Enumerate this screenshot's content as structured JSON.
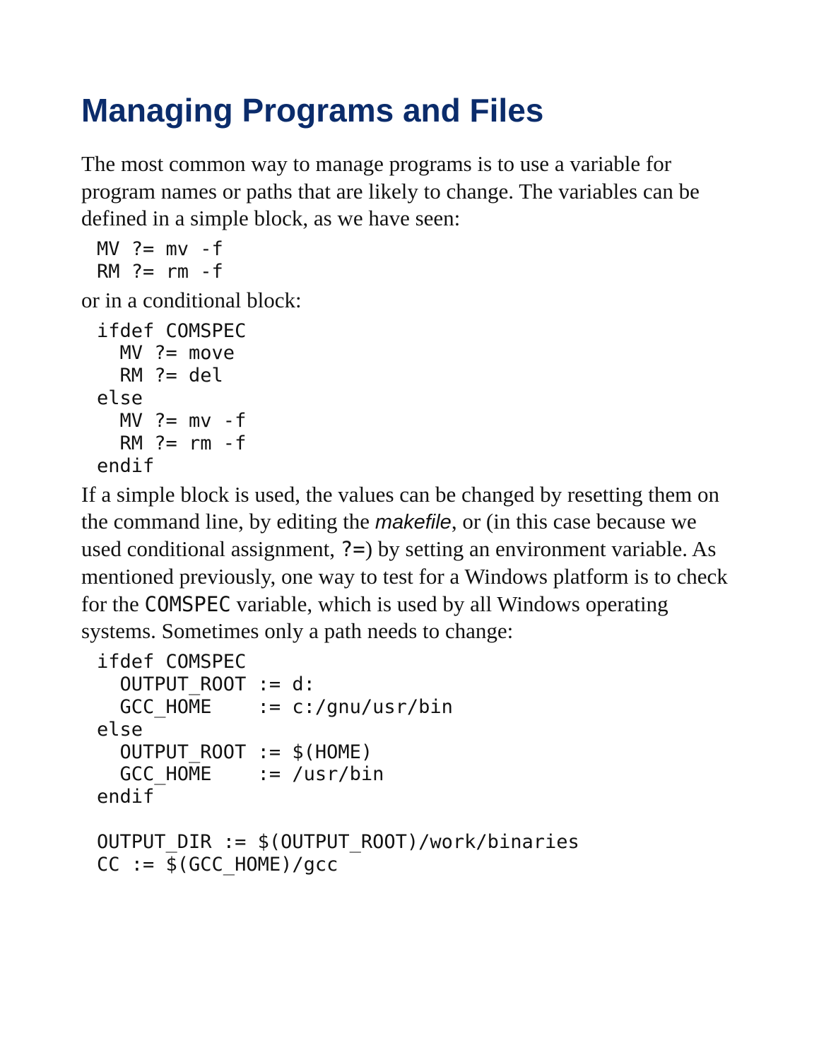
{
  "heading": "Managing Programs and Files",
  "p1": "The most common way to manage programs is to use a variable for program names or paths that are likely to change. The variables can be defined in a simple block, as we have seen:",
  "code1": "MV ?= mv -f\nRM ?= rm -f",
  "p2": "or in a conditional block:",
  "code2": "ifdef COMSPEC\n  MV ?= move\n  RM ?= del\nelse\n  MV ?= mv -f\n  RM ?= rm -f\nendif",
  "p3a": "If a simple block is used, the values can be changed by resetting them on the command line, by editing the ",
  "p3_it": "makefile",
  "p3b": ", or (in this case because we used conditional assignment, ",
  "p3_mono1": "?=",
  "p3c": ") by setting an environment variable. As mentioned previously, one way to test for a Windows platform is to check for the ",
  "p3_mono2": "COMSPEC",
  "p3d": " variable, which is used by all Windows operating systems. Sometimes only a path needs to change:",
  "code3": "ifdef COMSPEC\n  OUTPUT_ROOT := d:\n  GCC_HOME    := c:/gnu/usr/bin\nelse\n  OUTPUT_ROOT := $(HOME)\n  GCC_HOME    := /usr/bin\nendif\n\nOUTPUT_DIR := $(OUTPUT_ROOT)/work/binaries\nCC := $(GCC_HOME)/gcc"
}
